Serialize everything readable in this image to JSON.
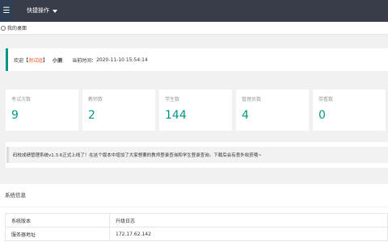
{
  "topbar": {
    "menu_icon": "hamburger-icon",
    "quick_ops_label": "快捷操作"
  },
  "tabs": {
    "home_label": "我的桌面"
  },
  "welcome": {
    "prefix": "欢迎【",
    "role": "测试组",
    "suffix": "】",
    "username": "小测",
    "time_label": "当前时间：",
    "time_value": "2020-11-10 15:54:14"
  },
  "stats": [
    {
      "label": "考试次数",
      "value": "9"
    },
    {
      "label": "教师数",
      "value": "2"
    },
    {
      "label": "学生数",
      "value": "144"
    },
    {
      "label": "管理员数",
      "value": "4"
    },
    {
      "label": "带看数",
      "value": "0"
    }
  ],
  "notice": {
    "text": "码校成绩管理系统v1.3.6正式上线了！在这个版本中增加了大家想要的教师登录查询和学生登录查询。下载后会有意外收获哦~"
  },
  "sysinfo": {
    "title": "系统信息",
    "rows": [
      {
        "key": "系统版本",
        "value": "升级日志"
      },
      {
        "key": "服务器地址",
        "value": "172.17.62.142"
      }
    ]
  },
  "colors": {
    "accent": "#009688",
    "topbar": "#393d49",
    "highlight": "#ff5722"
  }
}
